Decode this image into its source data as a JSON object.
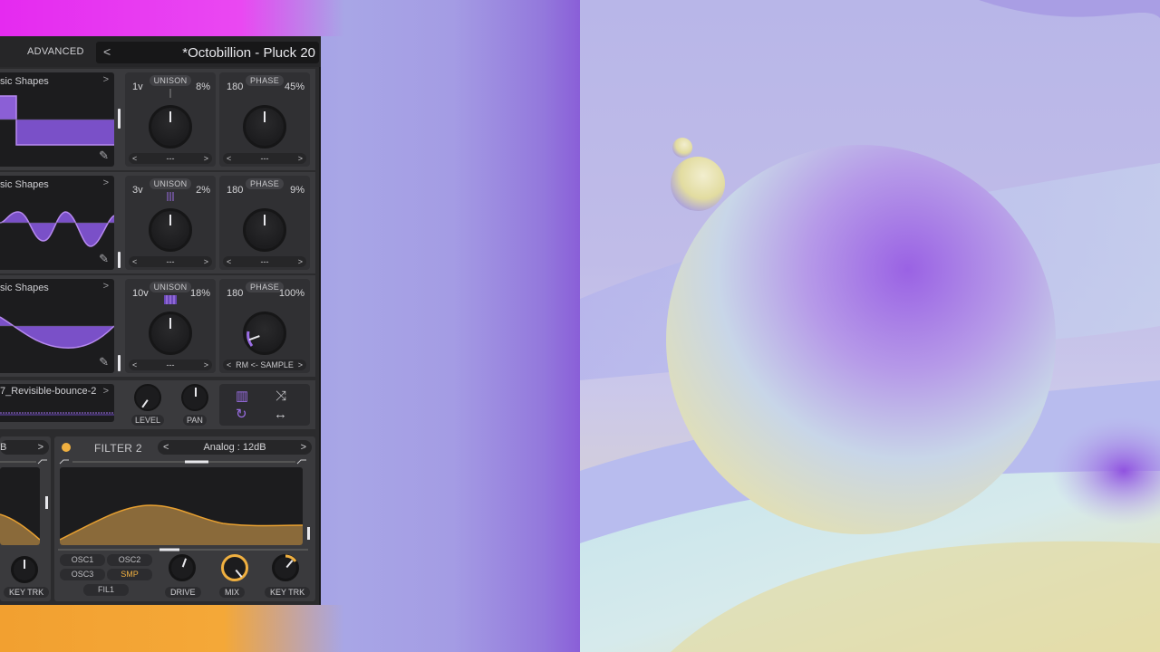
{
  "synth": {
    "topbar": {
      "advanced_label": "ADVANCED",
      "prev_icon": "chevron-left-icon",
      "preset_name": "*Octobillion - Pluck 20"
    },
    "oscillators": [
      {
        "wavetable": "sic Shapes",
        "unison_voices": "1v",
        "unison_title": "UNISON",
        "unison_detune": "8%",
        "phase_value": "180",
        "phase_title": "PHASE",
        "phase_random": "45%",
        "unison_mode": "---",
        "phase_mode": "---"
      },
      {
        "wavetable": "sic Shapes",
        "unison_voices": "3v",
        "unison_title": "UNISON",
        "unison_detune": "2%",
        "phase_value": "180",
        "phase_title": "PHASE",
        "phase_random": "9%",
        "unison_mode": "---",
        "phase_mode": "---"
      },
      {
        "wavetable": "sic Shapes",
        "unison_voices": "10v",
        "unison_title": "UNISON",
        "unison_detune": "18%",
        "phase_value": "180",
        "phase_title": "PHASE",
        "phase_random": "100%",
        "unison_mode": "---",
        "phase_mode": "RM <- SAMPLE"
      }
    ],
    "sample": {
      "name": "7_Revisible-bounce-2",
      "level_label": "LEVEL",
      "pan_label": "PAN"
    },
    "filter1": {
      "type_fragment": "B",
      "key_track_label": "KEY TRK"
    },
    "filter2": {
      "title": "FILTER 2",
      "type": "Analog : 12dB",
      "routes": [
        "OSC1",
        "OSC2",
        "OSC3",
        "SMP"
      ],
      "route_active": "SMP",
      "fil_route": "FIL1",
      "drive_label": "DRIVE",
      "mix_label": "MIX",
      "key_track_label": "KEY TRK",
      "accent_color": "#f0b040"
    },
    "accent_color": "#9b6ee6"
  }
}
